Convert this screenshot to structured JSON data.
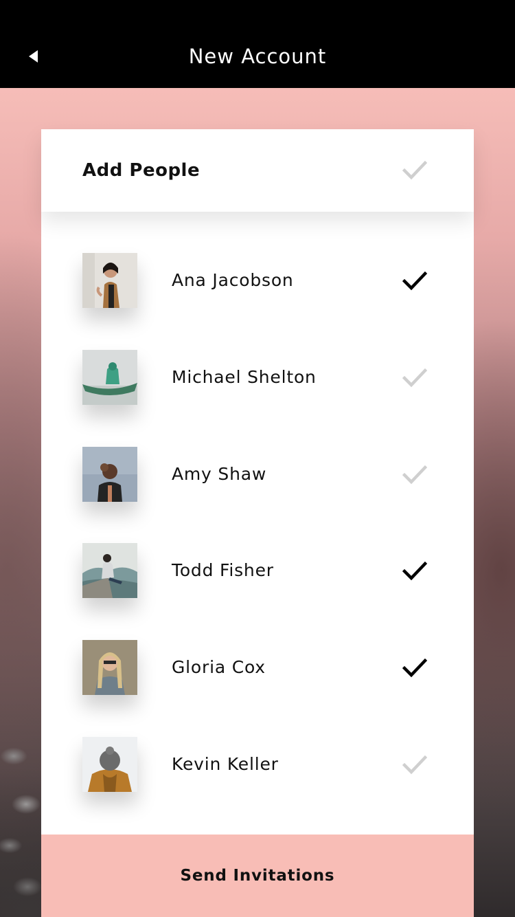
{
  "header": {
    "title": "New Account",
    "back_icon": "back-arrow-icon"
  },
  "card": {
    "title": "Add People",
    "header_check_state": "unchecked",
    "people": [
      {
        "name": "Ana Jacobson",
        "checked": true
      },
      {
        "name": "Michael Shelton",
        "checked": false
      },
      {
        "name": "Amy Shaw",
        "checked": false
      },
      {
        "name": "Todd Fisher",
        "checked": true
      },
      {
        "name": "Gloria Cox",
        "checked": true
      },
      {
        "name": "Kevin Keller",
        "checked": false
      }
    ],
    "send_label": "Send Invitations"
  },
  "colors": {
    "accent": "#f8bdb6",
    "check_on": "#000000",
    "check_off": "#cfcfcf",
    "topbar": "#000000"
  }
}
